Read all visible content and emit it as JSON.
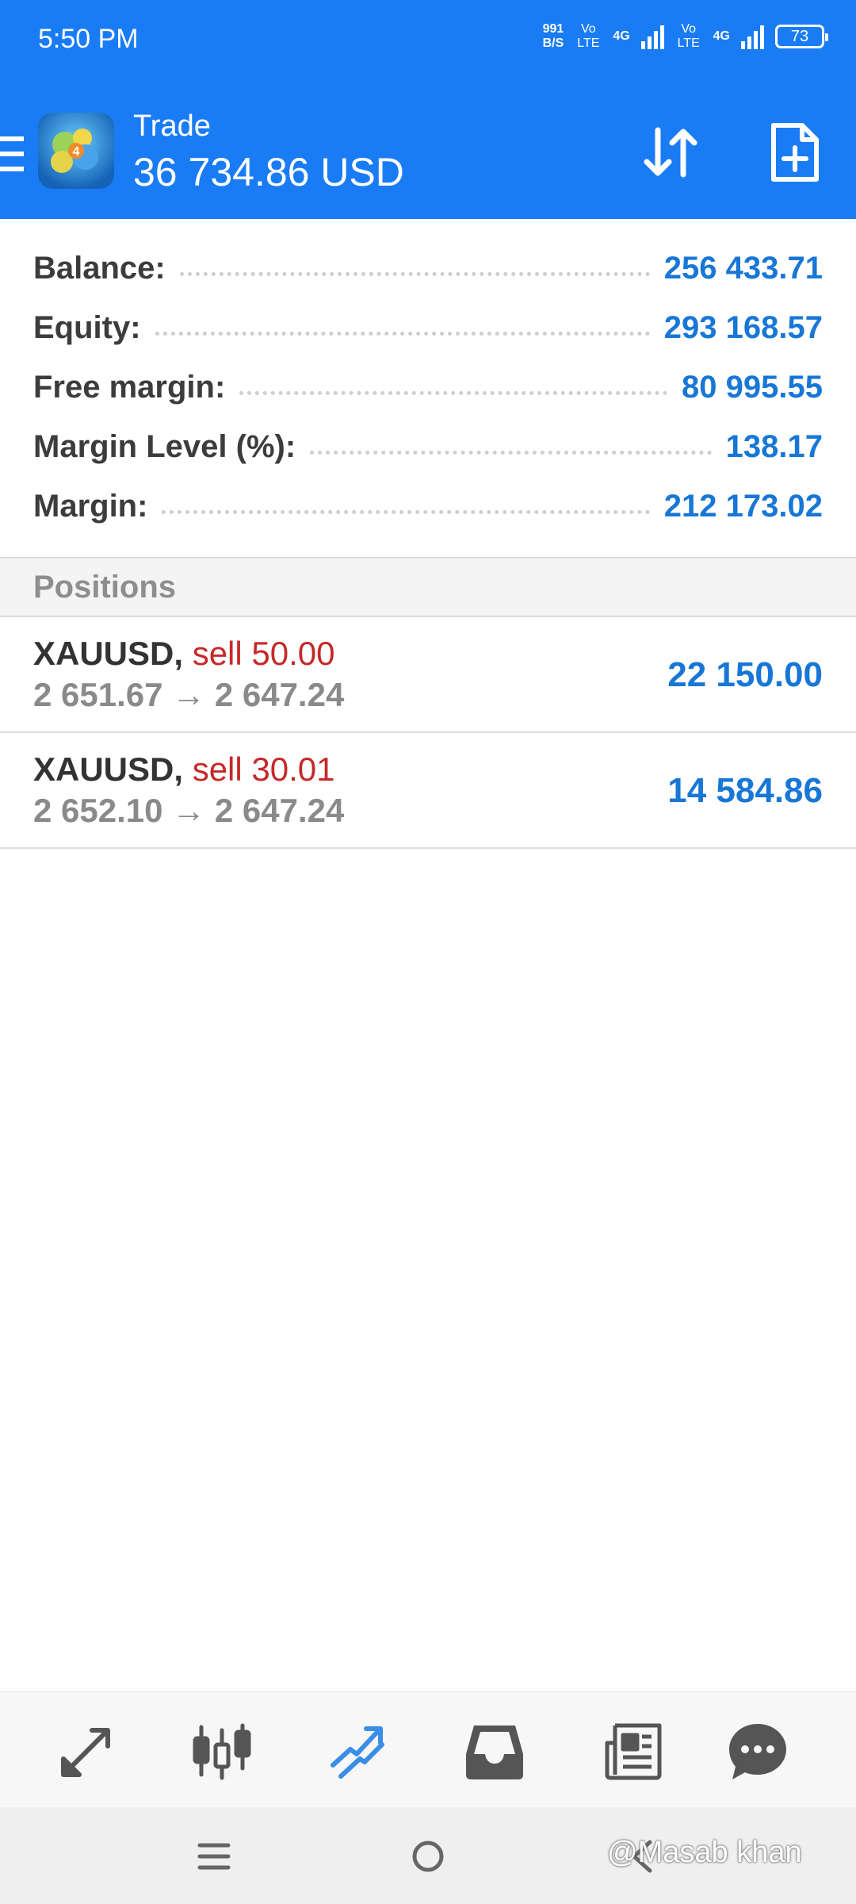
{
  "status_bar": {
    "time": "5:50 PM",
    "net_speed_value": "991",
    "net_speed_unit": "B/S",
    "volte_1": "Vo LTE",
    "network_1": "4G",
    "volte_2": "Vo LTE",
    "network_2": "4G",
    "battery": "73"
  },
  "header": {
    "title": "Trade",
    "balance": "36 734.86 USD",
    "colors": {
      "background": "#1a7cf5",
      "text": "#ffffff"
    },
    "icons": [
      "menu-icon",
      "sort-arrows-icon",
      "new-order-icon"
    ]
  },
  "summary": {
    "rows": [
      {
        "label": "Balance:",
        "value": "256 433.71"
      },
      {
        "label": "Equity:",
        "value": "293 168.57"
      },
      {
        "label": "Free margin:",
        "value": "80 995.55"
      },
      {
        "label": "Margin Level (%):",
        "value": "138.17"
      },
      {
        "label": "Margin:",
        "value": "212 173.02"
      }
    ],
    "value_color": "#1877d6"
  },
  "positions": {
    "title": "Positions",
    "items": [
      {
        "symbol": "XAUUSD,",
        "side": "sell 50.00",
        "prices": "2 651.67 → 2 647.24",
        "profit": "22 150.00"
      },
      {
        "symbol": "XAUUSD,",
        "side": "sell 30.01",
        "prices": "2 652.10 → 2 647.24",
        "profit": "14 584.86"
      }
    ],
    "side_color": "#c62828"
  },
  "bottom_nav": {
    "items": [
      "quotes-icon",
      "chart-icon",
      "trade-icon",
      "history-icon",
      "news-icon",
      "messages-icon"
    ],
    "active": "trade-icon",
    "active_color": "#3a8ee6",
    "inactive_color": "#555555"
  },
  "system_nav": {
    "items": [
      "recents-icon",
      "home-icon",
      "back-icon"
    ]
  },
  "watermark": "@Masab khan"
}
